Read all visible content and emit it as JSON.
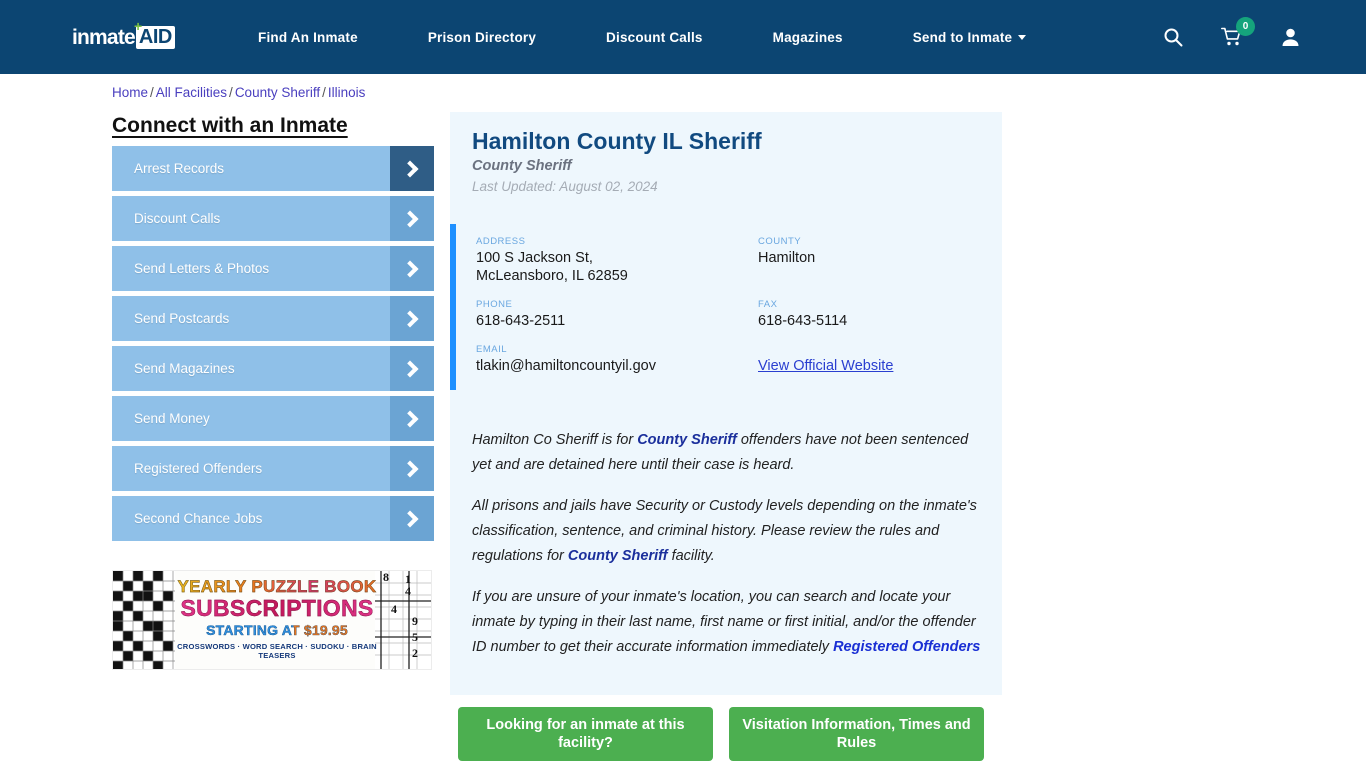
{
  "header": {
    "logo": {
      "word": "inmate",
      "badge": "AID",
      "plus": "+"
    },
    "nav": [
      {
        "label": "Find An Inmate"
      },
      {
        "label": "Prison Directory"
      },
      {
        "label": "Discount Calls"
      },
      {
        "label": "Magazines"
      },
      {
        "label": "Send to Inmate",
        "has_caret": true
      }
    ],
    "icons": [
      {
        "name": "search-icon"
      },
      {
        "name": "cart-icon",
        "badge": "0"
      },
      {
        "name": "user-icon"
      }
    ],
    "background_color": "#0c4572",
    "badge_color": "#15a47c"
  },
  "breadcrumb": {
    "items": [
      "Home",
      "All Facilities",
      "County Sheriff",
      "Illinois"
    ],
    "separator": "/"
  },
  "sidebar": {
    "title": "Connect with an Inmate",
    "items": [
      {
        "label": "Arrest Records",
        "active": true
      },
      {
        "label": "Discount Calls",
        "active": false
      },
      {
        "label": "Send Letters & Photos",
        "active": false
      },
      {
        "label": "Send Postcards",
        "active": false
      },
      {
        "label": "Send Magazines",
        "active": false
      },
      {
        "label": "Send Money",
        "active": false
      },
      {
        "label": "Registered Offenders",
        "active": false
      },
      {
        "label": "Second Chance Jobs",
        "active": false
      }
    ]
  },
  "ad": {
    "line1": "YEARLY PUZZLE BOOK",
    "line2": "SUBSCRIPTIONS",
    "line3": "STARTING AT $19.95",
    "line4": "CROSSWORDS · WORD SEARCH · SUDOKU · BRAIN TEASERS",
    "sudoku_digits": [
      "8",
      "1",
      "4",
      "4",
      "9",
      "5",
      "2"
    ]
  },
  "facility": {
    "title": "Hamilton County IL Sheriff",
    "type": "County Sheriff",
    "last_updated": "Last Updated: August 02, 2024",
    "fields": {
      "address_label": "ADDRESS",
      "address_line1": "100 S Jackson St,",
      "address_line2": "McLeansboro, IL 62859",
      "county_label": "COUNTY",
      "county_value": "Hamilton",
      "phone_label": "PHONE",
      "phone_value": "618-643-2511",
      "fax_label": "FAX",
      "fax_value": "618-643-5114",
      "email_label": "EMAIL",
      "email_value": "tlakin@hamiltoncountyil.gov",
      "website_link": "View Official Website"
    },
    "paragraphs": {
      "p1_a": "Hamilton Co Sheriff is for ",
      "p1_link": "County Sheriff",
      "p1_b": " offenders have not been sentenced yet and are detained here until their case is heard.",
      "p2_a": "All prisons and jails have Security or Custody levels depending on the inmate's classification, sentence, and criminal history. Please review the rules and regulations for ",
      "p2_link": "County Sheriff",
      "p2_b": " facility.",
      "p3_a": "If you are unsure of your inmate's location, you can search and locate your inmate by typing in their last name, first name or first initial, and/or the offender ID number to get their accurate information immediately ",
      "p3_link": "Registered Offenders"
    },
    "accent_color": "#1e90ff",
    "panel_color": "#eef7fd"
  },
  "cta": {
    "primary": "Looking for an inmate at this facility?",
    "secondary": "Visitation Information, Times and Rules",
    "color": "#4caf50"
  }
}
